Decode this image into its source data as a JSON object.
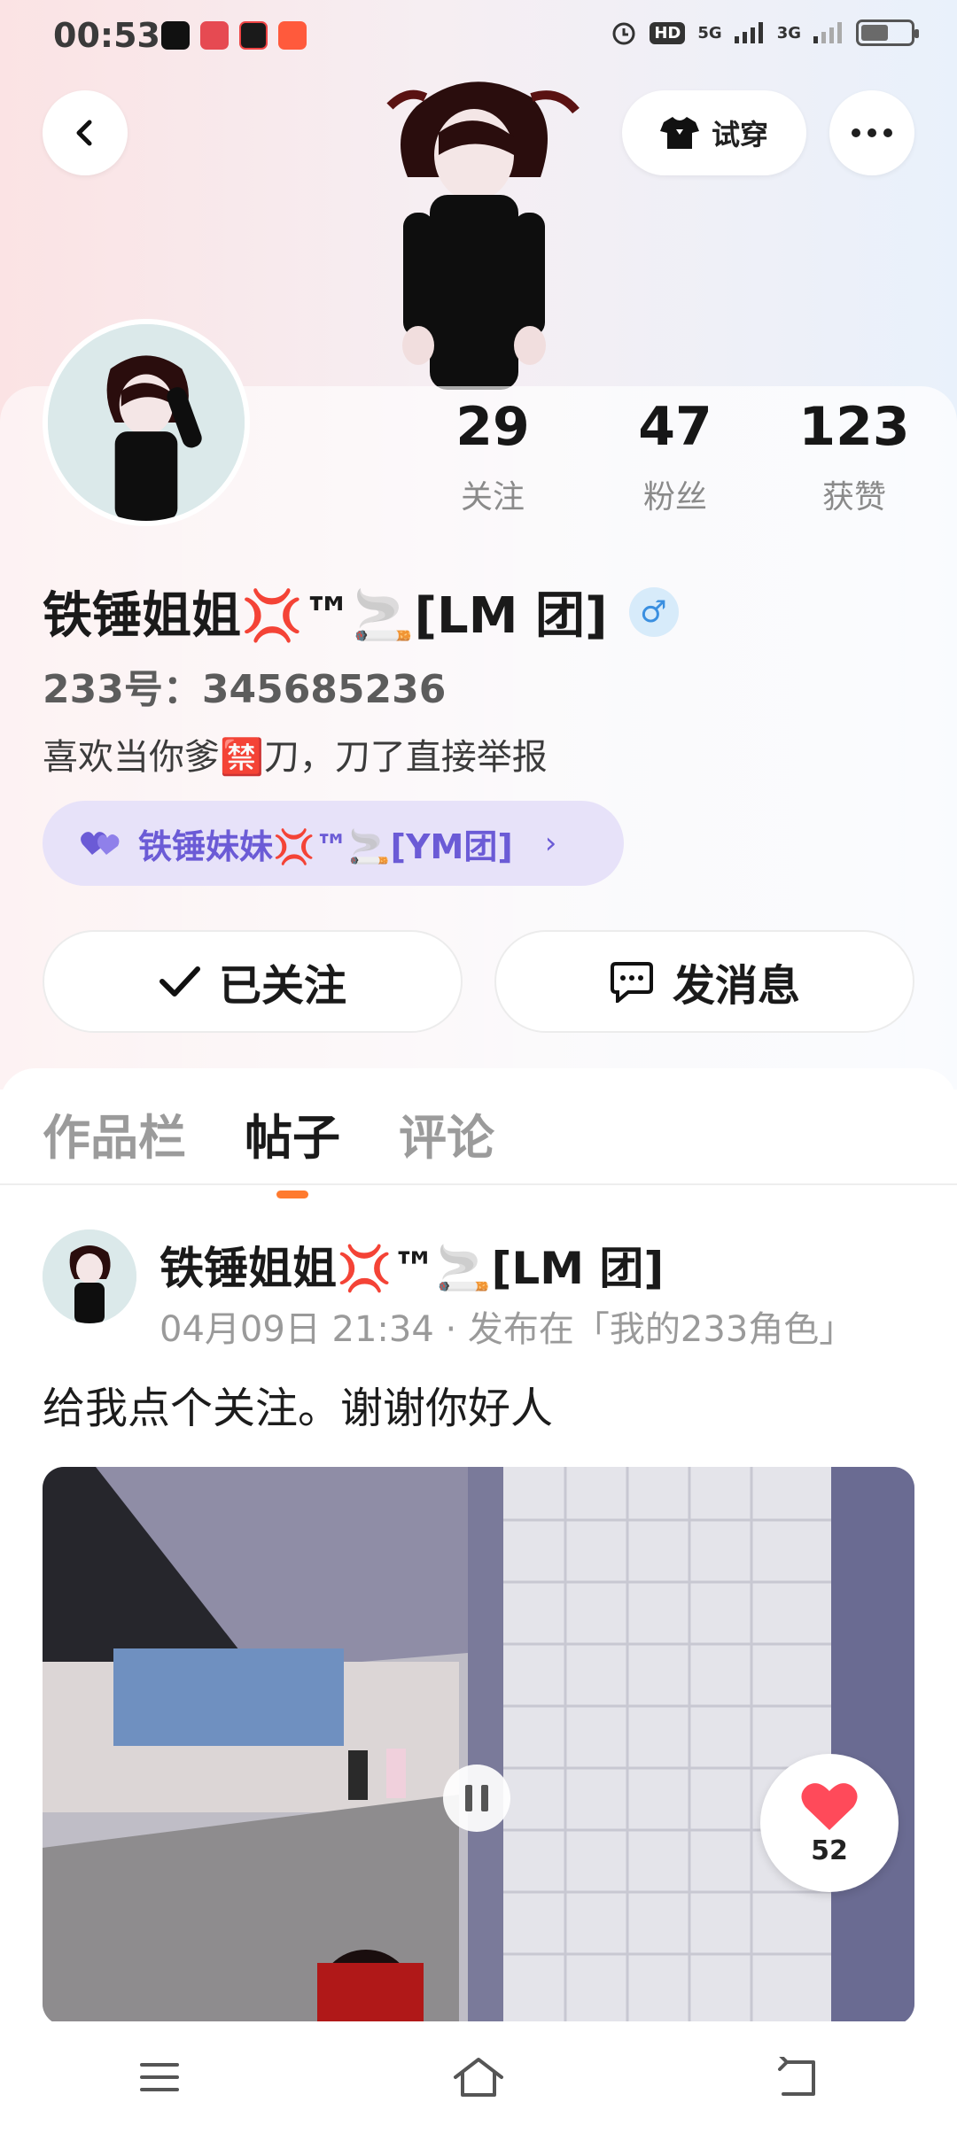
{
  "status_bar": {
    "time": "00:53",
    "network_a": "5G",
    "network_b": "3G",
    "hd_label": "HD"
  },
  "header": {
    "try_on_label": "试穿"
  },
  "stats": [
    {
      "value": "29",
      "label": "关注"
    },
    {
      "value": "47",
      "label": "粉丝"
    },
    {
      "value": "123",
      "label": "获赞"
    }
  ],
  "profile": {
    "name": "铁锤姐姐💢™🚬[LM 团]",
    "id_line": "233号：345685236",
    "bio": "喜欢当你爹🈲刀，刀了直接举报",
    "cp_name": "铁锤妹妹💢™🚬[YM团]"
  },
  "actions": {
    "followed_label": "已关注",
    "message_label": "发消息"
  },
  "tabs": [
    {
      "label": "作品栏",
      "active": false
    },
    {
      "label": "帖子",
      "active": true
    },
    {
      "label": "评论",
      "active": false
    }
  ],
  "post": {
    "author": "铁锤姐姐💢™🚬[LM 团]",
    "meta": "04月09日 21:34 · 发布在「我的233角色」",
    "text": "给我点个关注。谢谢你好人",
    "likes": "52"
  },
  "colors": {
    "accent_orange": "#ff7a2e",
    "cp_purple": "#6b5bd6",
    "like_red": "#ff4a5a"
  }
}
